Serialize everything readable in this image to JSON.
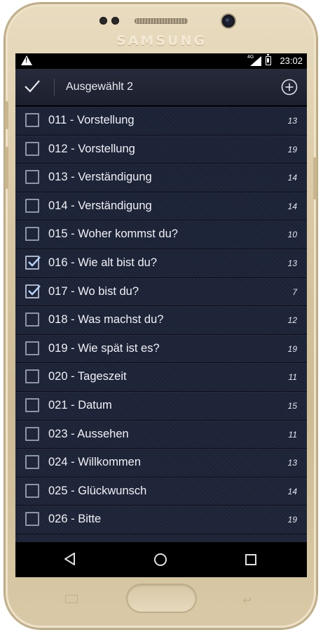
{
  "device": {
    "brand": "SAMSUNG"
  },
  "statusbar": {
    "network": "4G",
    "time": "23:02"
  },
  "appbar": {
    "title": "Ausgewählt 2"
  },
  "lessons": [
    {
      "label": "011 - Vorstellung",
      "count": "13",
      "checked": false
    },
    {
      "label": "012 - Vorstellung",
      "count": "19",
      "checked": false
    },
    {
      "label": "013 - Verständigung",
      "count": "14",
      "checked": false
    },
    {
      "label": "014 - Verständigung",
      "count": "14",
      "checked": false
    },
    {
      "label": "015 - Woher kommst du?",
      "count": "10",
      "checked": false
    },
    {
      "label": "016 - Wie alt bist du?",
      "count": "13",
      "checked": true
    },
    {
      "label": "017 - Wo bist du?",
      "count": "7",
      "checked": true
    },
    {
      "label": "018 - Was machst du?",
      "count": "12",
      "checked": false
    },
    {
      "label": "019 - Wie spät ist es?",
      "count": "19",
      "checked": false
    },
    {
      "label": "020 - Tageszeit",
      "count": "11",
      "checked": false
    },
    {
      "label": "021 - Datum",
      "count": "15",
      "checked": false
    },
    {
      "label": "023 - Aussehen",
      "count": "11",
      "checked": false
    },
    {
      "label": "024 - Willkommen",
      "count": "13",
      "checked": false
    },
    {
      "label": "025 - Glückwunsch",
      "count": "14",
      "checked": false
    },
    {
      "label": "026 - Bitte",
      "count": "19",
      "checked": false
    }
  ],
  "colors": {
    "list_bg": "#1b2236",
    "appbar_bg": "#262a3a",
    "text": "#f1f2f5",
    "phone_gold": "#d8c7a3"
  }
}
